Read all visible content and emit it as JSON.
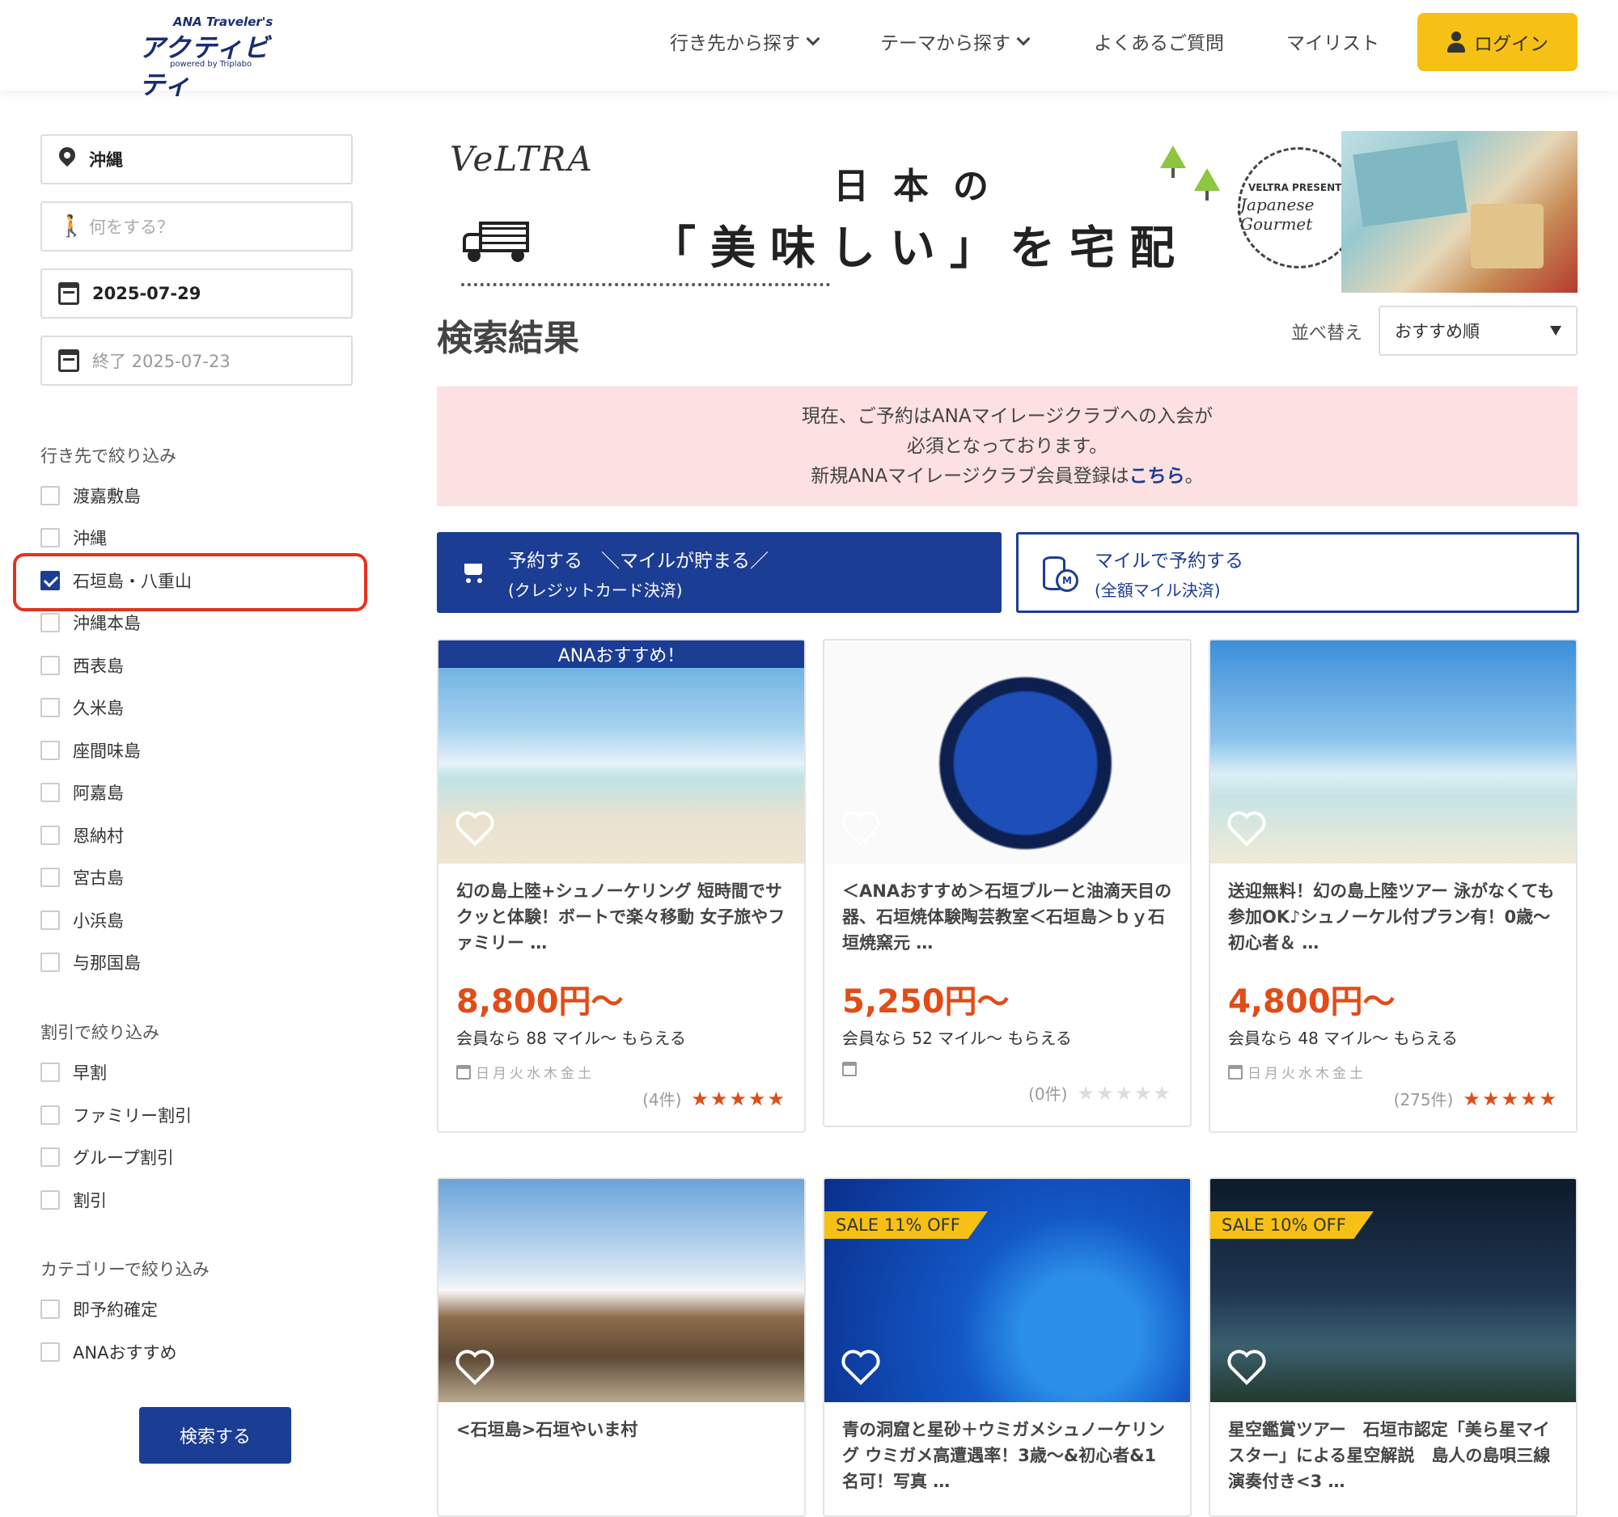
{
  "header": {
    "logo_small": "ANA Traveler's",
    "logo_main": "アクティビティ",
    "logo_by": "powered by Triplabo",
    "nav": [
      "行き先から探す",
      "テーマから探す",
      "よくあるご質問",
      "マイリスト"
    ],
    "login_label": "ログイン"
  },
  "search": {
    "location_value": "沖縄",
    "activity_placeholder": "何をする？",
    "start_date": "2025-07-29",
    "end_date_placeholder": "終了 2025-07-23"
  },
  "filters": {
    "destination_title": "行き先で絞り込み",
    "destinations": [
      {
        "label": "渡嘉敷島",
        "checked": false
      },
      {
        "label": "沖縄",
        "checked": false
      },
      {
        "label": "石垣島・八重山",
        "checked": true
      },
      {
        "label": "沖縄本島",
        "checked": false
      },
      {
        "label": "西表島",
        "checked": false
      },
      {
        "label": "久米島",
        "checked": false
      },
      {
        "label": "座間味島",
        "checked": false
      },
      {
        "label": "阿嘉島",
        "checked": false
      },
      {
        "label": "恩納村",
        "checked": false
      },
      {
        "label": "宮古島",
        "checked": false
      },
      {
        "label": "小浜島",
        "checked": false
      },
      {
        "label": "与那国島",
        "checked": false
      }
    ],
    "discount_title": "割引で絞り込み",
    "discounts": [
      "早割",
      "ファミリー割引",
      "グループ割引",
      "割引"
    ],
    "category_title": "カテゴリーで絞り込み",
    "categories": [
      "即予約確定",
      "ANAおすすめ"
    ],
    "search_button": "検索する"
  },
  "banner": {
    "brand": "VeLTRA",
    "line1": "日本の",
    "line2": "「美味しい」を宅配",
    "badge1": "VELTRA PRESENTS",
    "badge2": "Japanese Gourmet"
  },
  "results": {
    "title": "検索結果",
    "sort_label": "並べ替え",
    "sort_value": "おすすめ順",
    "notice_line1": "現在、ご予約はANAマイレージクラブへの入会が",
    "notice_line2": "必須となっております。",
    "notice_line3": "新規ANAマイレージクラブ会員登録は",
    "notice_link": "こちら",
    "notice_end": "。"
  },
  "payment": {
    "primary_l1": "予約する　＼マイルが貯まる／",
    "primary_l2": "(クレジットカード決済)",
    "secondary_l1": "マイルで予約する",
    "secondary_l2": "(全額マイル決済)"
  },
  "cards": [
    {
      "ribbon": "ANAおすすめ！",
      "title": "幻の島上陸+シュノーケリング 短時間でサクッと体験！ボートで楽々移動 女子旅やファミリー …",
      "price": "8,800円〜",
      "miles": "会員なら 88 マイル〜 もらえる",
      "days": "日月火水木金土",
      "reviews": "(4件)",
      "stars": "★★★★★",
      "rating": 5
    },
    {
      "title": "＜ANAおすすめ＞石垣ブルーと油滴天目の器、石垣焼体験陶芸教室＜石垣島＞ｂｙ石垣焼窯元 …",
      "price": "5,250円〜",
      "miles": "会員なら 52 マイル〜 もらえる",
      "days": "",
      "reviews": "(0件)",
      "stars": "★★★★★",
      "rating": 0
    },
    {
      "title": "送迎無料！幻の島上陸ツアー 泳がなくても参加OK♪シュノーケル付プラン有！0歳〜初心者＆ …",
      "price": "4,800円〜",
      "miles": "会員なら 48 マイル〜 もらえる",
      "days": "日月火水木金土",
      "reviews": "(275件)",
      "stars": "★★★★★",
      "rating": 4.5
    },
    {
      "title": "<石垣島>石垣やいま村"
    },
    {
      "sale": "SALE 11% OFF",
      "title": "青の洞窟と星砂＋ウミガメシュノーケリング ウミガメ高遭遇率！3歳〜&初心者&1名可！写真 …"
    },
    {
      "sale": "SALE 10% OFF",
      "title": "星空鑑賞ツアー　石垣市認定「美ら星マイスター」による星空解説　島人の島唄三線演奏付き<3 …"
    }
  ],
  "colors": {
    "brand_navy": "#1c3d94",
    "accent_yellow": "#f6c114",
    "price_orange": "#e14c17",
    "notice_pink": "#fde0e2",
    "highlight_red": "#e5321f"
  }
}
